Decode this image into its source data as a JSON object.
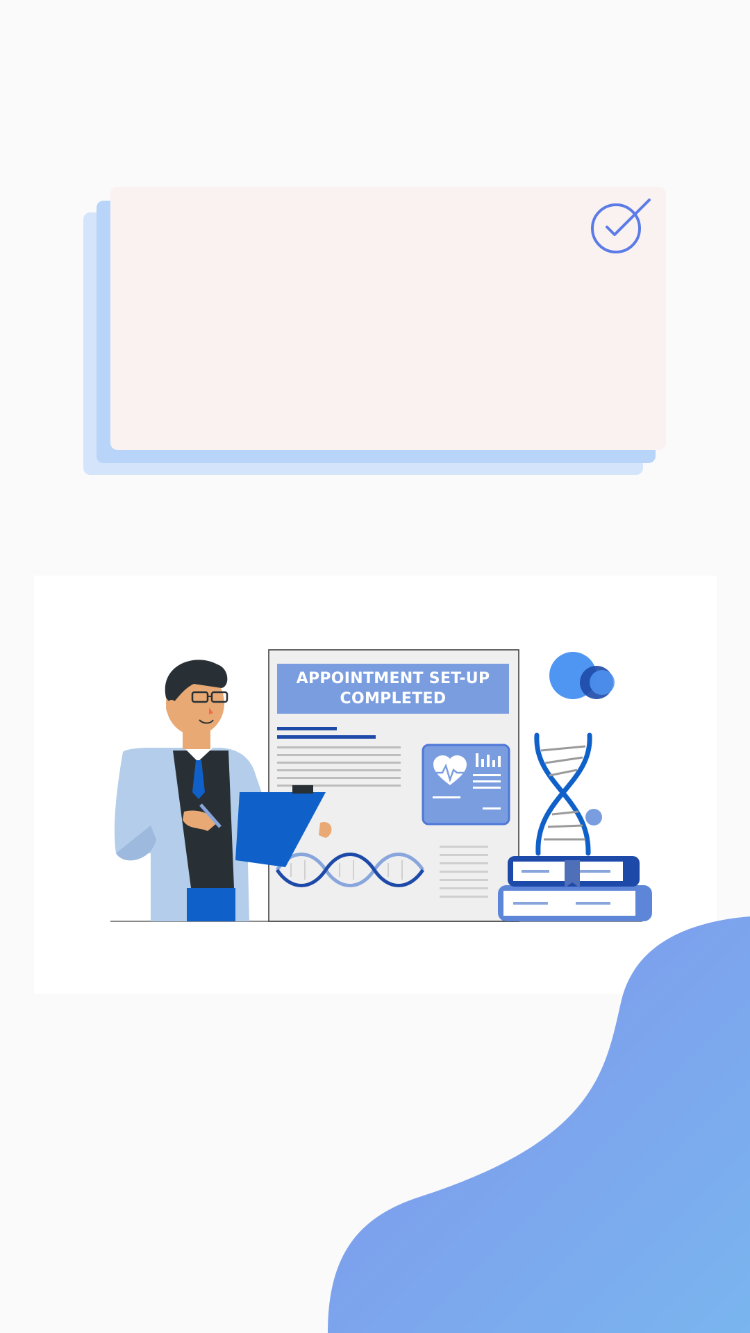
{
  "illustration": {
    "title_line1": "APPOINTMENT SET-UP",
    "title_line2": "COMPLETED"
  },
  "icons": {
    "check": "check-circle-icon",
    "heart": "heart-monitor-icon",
    "dna": "dna-helix-icon",
    "books": "book-stack-icon"
  },
  "colors": {
    "accent": "#5b7be6",
    "card_bg": "#faf2f1",
    "stack_back": "#d3e4fb",
    "stack_mid": "#b8d4f8",
    "document_header": "#7a9de0",
    "blob_start": "#7f93eb",
    "blob_end": "#7ab5ef",
    "page_bg": "#fafafa"
  }
}
